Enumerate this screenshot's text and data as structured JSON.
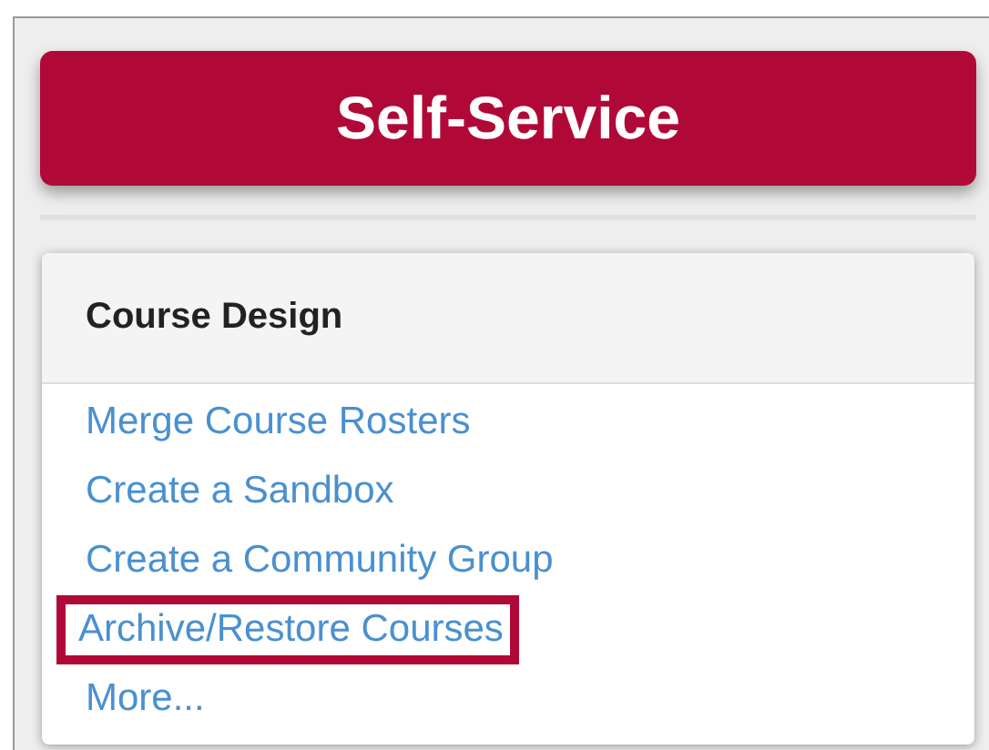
{
  "button": {
    "label": "Self-Service"
  },
  "panel": {
    "title": "Course Design",
    "links": [
      {
        "label": "Merge Course Rosters",
        "highlighted": false
      },
      {
        "label": "Create a Sandbox",
        "highlighted": false
      },
      {
        "label": "Create a Community Group",
        "highlighted": false
      },
      {
        "label": "Archive/Restore Courses",
        "highlighted": true
      },
      {
        "label": "More...",
        "highlighted": false
      }
    ]
  }
}
